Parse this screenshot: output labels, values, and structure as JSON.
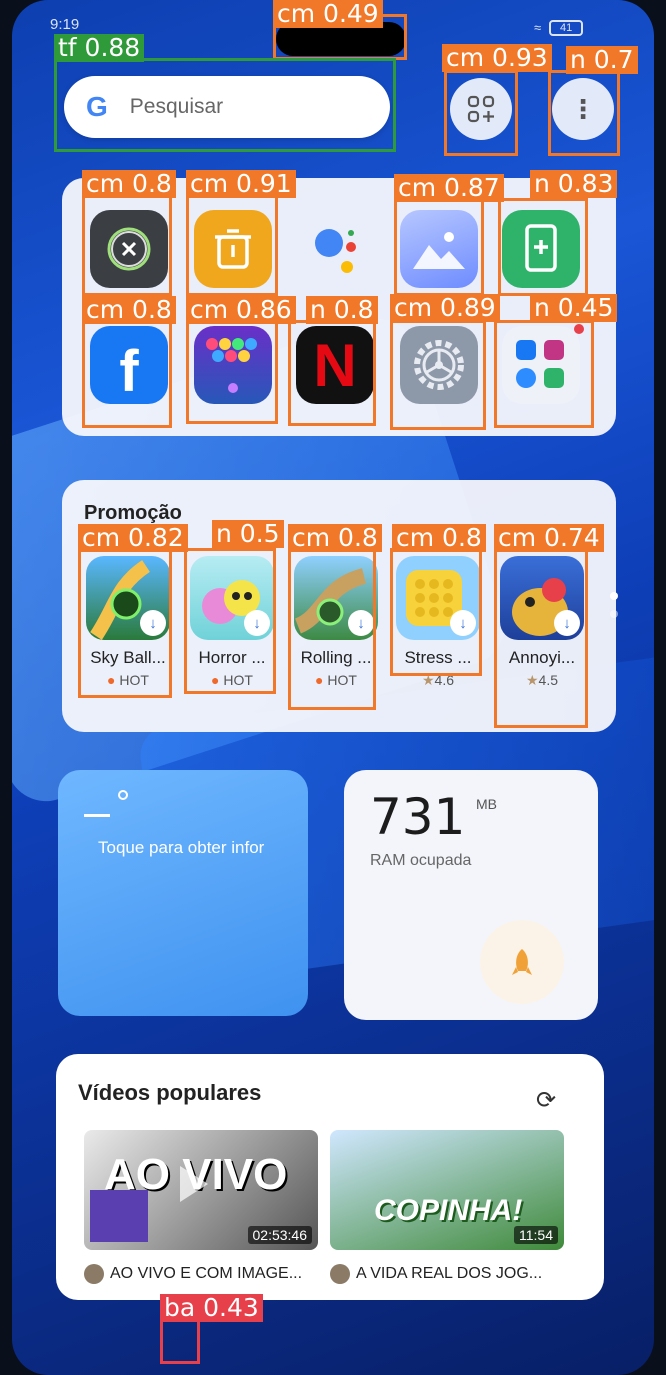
{
  "status": {
    "time": "9:19",
    "battery": "41"
  },
  "search": {
    "placeholder": "Pesquisar",
    "logo": "G"
  },
  "promo": {
    "title": "Promoção",
    "items": [
      {
        "name": "Sky Ball...",
        "sub": "HOT"
      },
      {
        "name": "Horror ...",
        "sub": "HOT"
      },
      {
        "name": "Rolling ...",
        "sub": "HOT"
      },
      {
        "name": "Stress ...",
        "sub": "4.6"
      },
      {
        "name": "Annoyi...",
        "sub": "4.5"
      }
    ]
  },
  "widget_left": {
    "text": "Toque para obter infor"
  },
  "widget_ram": {
    "value": "731",
    "unit": "MB",
    "label": "RAM ocupada"
  },
  "videos": {
    "title": "Vídeos populares",
    "items": [
      {
        "overlay": "AO VIVO",
        "duration": "02:53:46",
        "caption": "AO VIVO E COM IMAGE..."
      },
      {
        "overlay": "COPINHA!",
        "duration": "11:54",
        "caption": "A VIDA REAL DOS JOG..."
      }
    ]
  },
  "detections": [
    {
      "label": "cm 0.49"
    },
    {
      "label": "tf 0.88"
    },
    {
      "label": "cm 0.93"
    },
    {
      "label": "n 0.7"
    },
    {
      "label": "cm 0.8"
    },
    {
      "label": "cm 0.91"
    },
    {
      "label": "cm 0.87"
    },
    {
      "label": "n 0.83"
    },
    {
      "label": "cm 0.8"
    },
    {
      "label": "cm 0.86"
    },
    {
      "label": "n 0.8"
    },
    {
      "label": "cm 0.89"
    },
    {
      "label": "n 0.45"
    },
    {
      "label": "cm 0.82"
    },
    {
      "label": "n 0.5"
    },
    {
      "label": "cm 0.8"
    },
    {
      "label": "cm 0.8"
    },
    {
      "label": "cm 0.74"
    },
    {
      "label": "ba 0.43"
    }
  ]
}
